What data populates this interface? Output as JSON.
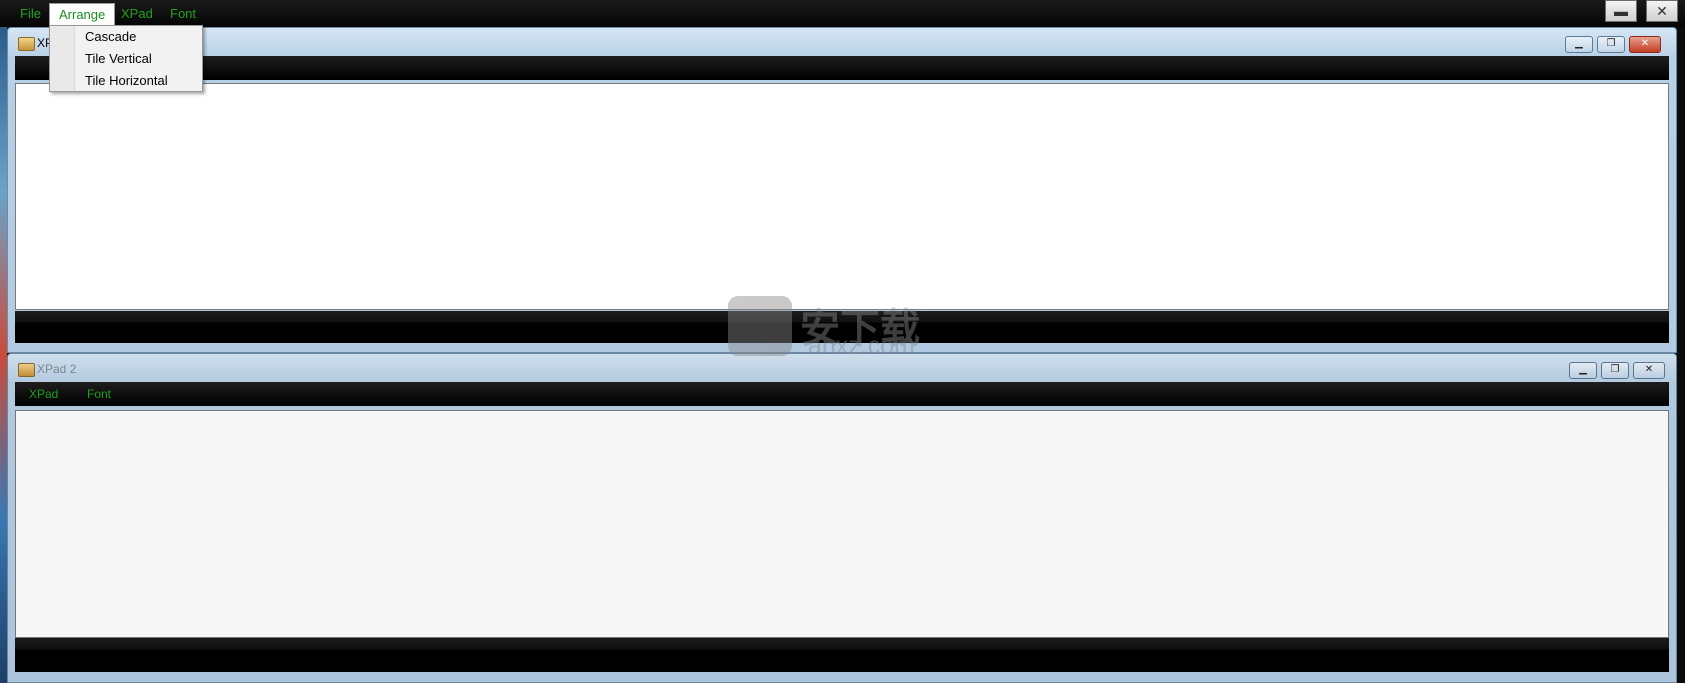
{
  "menubar": {
    "file": "File",
    "arrange": "Arrange",
    "xpad": "XPad",
    "font": "Font"
  },
  "arrange_menu": {
    "items": [
      "Cascade",
      "Tile Vertical",
      "Tile Horizontal"
    ]
  },
  "window1": {
    "title": "XPad 1"
  },
  "window2": {
    "title": "XPad 2",
    "menu_xpad": "XPad",
    "menu_font": "Font"
  },
  "watermark": {
    "text": "安下载",
    "url": "anxz.com"
  },
  "colors": {
    "menu_text": "#1fa31f",
    "menubar_bg": "#000000",
    "title_gradient_top": "#d6e6f4",
    "close_button": "#c33c24"
  },
  "icons": {
    "app": "xpad-notepad-icon",
    "minimize": "minimize-icon",
    "restore": "restore-icon",
    "close": "close-icon"
  }
}
